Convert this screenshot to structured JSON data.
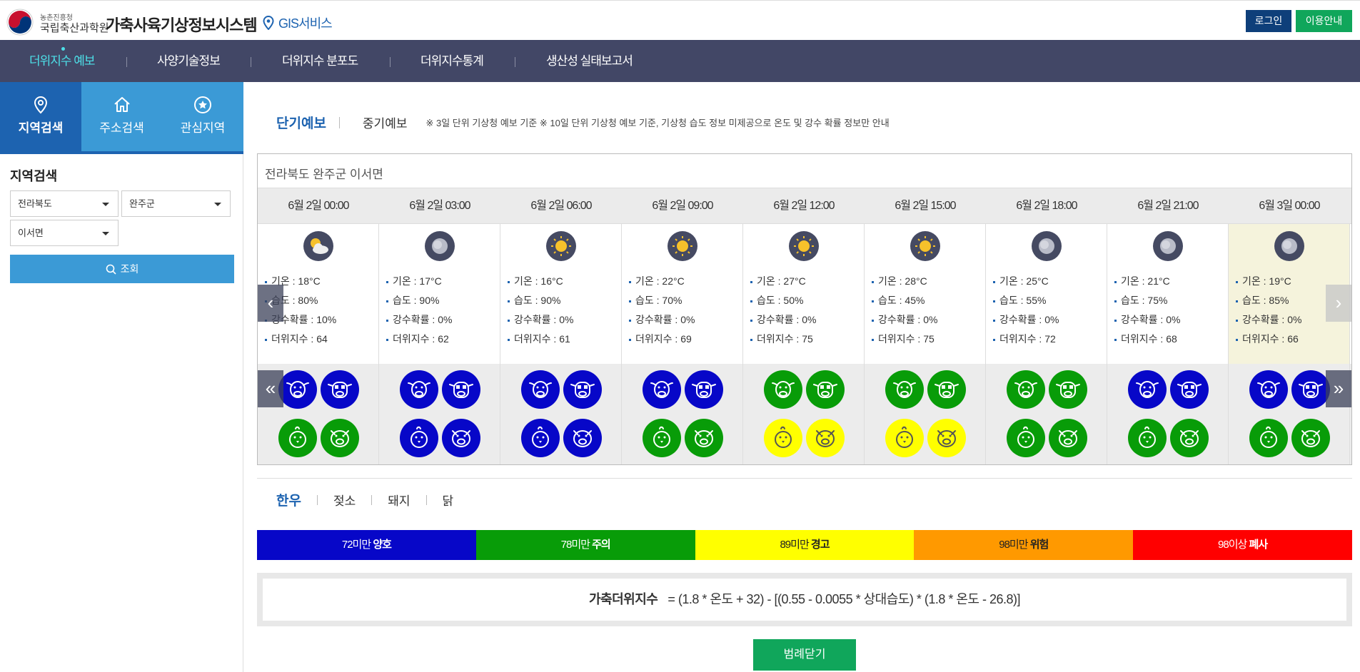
{
  "header": {
    "org_small": "농촌진흥청",
    "org_name": "국립축산과학원",
    "site_title": "가축사육기상정보시스템",
    "gis_label": "GIS서비스",
    "login": "로그인",
    "guide": "이용안내"
  },
  "nav": {
    "items": [
      "더위지수 예보",
      "사양기술정보",
      "더위지수 분포도",
      "더위지수통계",
      "생산성 실태보고서"
    ]
  },
  "sidebar": {
    "tabs": [
      "지역검색",
      "주소검색",
      "관심지역"
    ],
    "title": "지역검색",
    "province": "전라북도",
    "county": "완주군",
    "town": "이서면",
    "search": "조회"
  },
  "forecast": {
    "tab_short": "단기예보",
    "tab_mid": "중기예보",
    "note": "※ 3일 단위 기상청 예보 기준  ※ 10일 단위 기상청 예보 기준, 기상청 습도 정보 미제공으로 온도 및 강수 확률 정보만 안내",
    "location": "전라북도 완주군 이서면",
    "columns": [
      {
        "date": "6월 2일 00:00",
        "weather": "partly-cloudy-icon",
        "temp": "기온 : 18°C",
        "hum": "습도 : 80%",
        "rain": "강수확률 : 10%",
        "thi": "더위지수 : 64",
        "cattle": "blue",
        "dairy": "blue",
        "chicken": "green",
        "pig": "green"
      },
      {
        "date": "6월 2일 03:00",
        "weather": "cloudy-icon",
        "temp": "기온 : 17°C",
        "hum": "습도 : 90%",
        "rain": "강수확률 : 0%",
        "thi": "더위지수 : 62",
        "cattle": "blue",
        "dairy": "blue",
        "chicken": "blue",
        "pig": "blue"
      },
      {
        "date": "6월 2일 06:00",
        "weather": "sunny-icon",
        "temp": "기온 : 16°C",
        "hum": "습도 : 90%",
        "rain": "강수확률 : 0%",
        "thi": "더위지수 : 61",
        "cattle": "blue",
        "dairy": "blue",
        "chicken": "blue",
        "pig": "blue"
      },
      {
        "date": "6월 2일 09:00",
        "weather": "sunny-icon",
        "temp": "기온 : 22°C",
        "hum": "습도 : 70%",
        "rain": "강수확률 : 0%",
        "thi": "더위지수 : 69",
        "cattle": "blue",
        "dairy": "blue",
        "chicken": "green",
        "pig": "green"
      },
      {
        "date": "6월 2일 12:00",
        "weather": "sunny-icon",
        "temp": "기온 : 27°C",
        "hum": "습도 : 50%",
        "rain": "강수확률 : 0%",
        "thi": "더위지수 : 75",
        "cattle": "green",
        "dairy": "green",
        "chicken": "yellow",
        "pig": "yellow"
      },
      {
        "date": "6월 2일 15:00",
        "weather": "sunny-icon",
        "temp": "기온 : 28°C",
        "hum": "습도 : 45%",
        "rain": "강수확률 : 0%",
        "thi": "더위지수 : 75",
        "cattle": "green",
        "dairy": "green",
        "chicken": "yellow",
        "pig": "yellow"
      },
      {
        "date": "6월 2일 18:00",
        "weather": "cloudy-icon",
        "temp": "기온 : 25°C",
        "hum": "습도 : 55%",
        "rain": "강수확률 : 0%",
        "thi": "더위지수 : 72",
        "cattle": "green",
        "dairy": "green",
        "chicken": "green",
        "pig": "green"
      },
      {
        "date": "6월 2일 21:00",
        "weather": "cloudy-icon",
        "temp": "기온 : 21°C",
        "hum": "습도 : 75%",
        "rain": "강수확률 : 0%",
        "thi": "더위지수 : 68",
        "cattle": "blue",
        "dairy": "blue",
        "chicken": "green",
        "pig": "green"
      },
      {
        "date": "6월 3일 00:00",
        "weather": "cloudy-icon",
        "temp": "기온 : 19°C",
        "hum": "습도 : 85%",
        "rain": "강수확률 : 0%",
        "thi": "더위지수 : 66",
        "cattle": "blue",
        "dairy": "blue",
        "chicken": "green",
        "pig": "green"
      }
    ]
  },
  "species": [
    "한우",
    "젖소",
    "돼지",
    "닭"
  ],
  "legend": [
    {
      "range": "72미만",
      "level": "양호",
      "color": "#0707c8",
      "text": "#ffffff"
    },
    {
      "range": "78미만",
      "level": "주의",
      "color": "#089c08",
      "text": "#ffffff"
    },
    {
      "range": "89미만",
      "level": "경고",
      "color": "#ffff00",
      "text": "#222222"
    },
    {
      "range": "98미만",
      "level": "위험",
      "color": "#ff9900",
      "text": "#222222"
    },
    {
      "range": "98이상",
      "level": "폐사",
      "color": "#ff0000",
      "text": "#ffffff"
    }
  ],
  "formula": {
    "label": "가축더위지수",
    "expr": "= (1.8 * 온도 + 32) - [(0.55 - 0.0055 * 상대습도) * (1.8 * 온도 - 26.8)]"
  },
  "close_legend": "범례닫기",
  "colors": {
    "blue": "#0707c8",
    "green": "#089c08",
    "yellow": "#ffff00",
    "navy": "#424766",
    "accent": "#1d63b0"
  }
}
